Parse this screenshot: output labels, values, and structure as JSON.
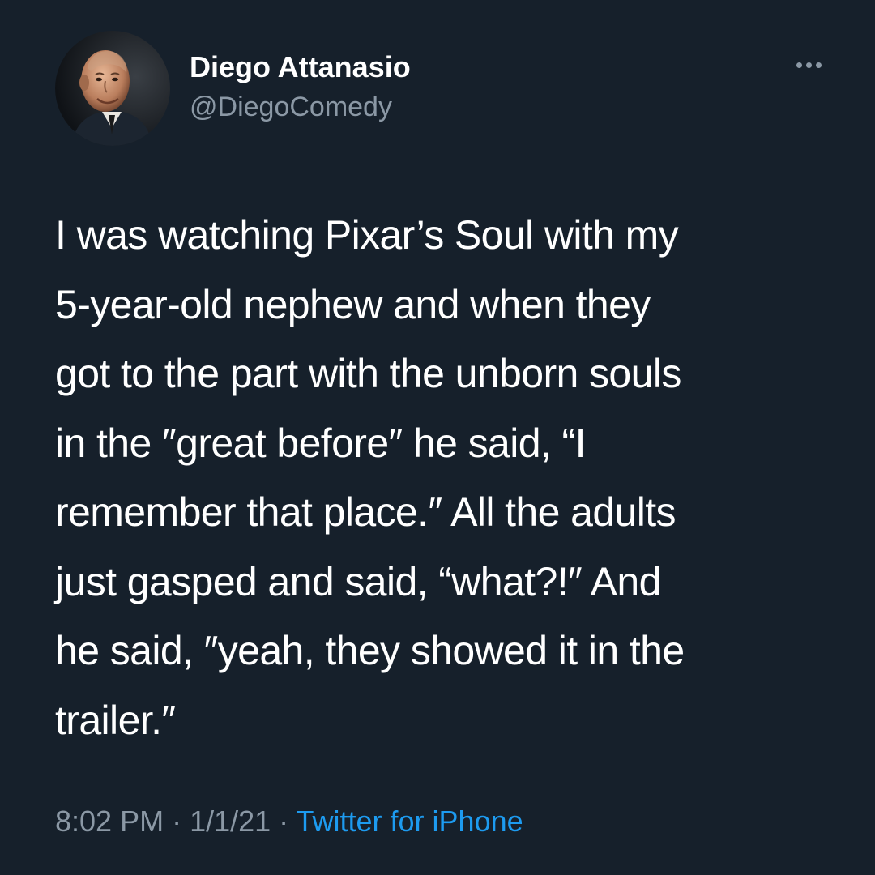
{
  "author": {
    "display_name": "Diego Attanasio",
    "handle": "@DiegoComedy",
    "avatar_icon": "profile-photo"
  },
  "menu": {
    "icon": "more-options-icon"
  },
  "tweet": {
    "text": "I was watching Pixar’s Soul with my\n5-year-old nephew and when they\ngot to the part with the unborn souls\nin the ″great before″ he said, “I\nremember that place.″ All the adults\njust gasped and said, “what?!″ And\nhe said, ″yeah, they showed it in the\ntrailer.″"
  },
  "meta": {
    "time": "8:02 PM",
    "separator": " · ",
    "date": "1/1/21",
    "source": "Twitter for iPhone"
  },
  "colors": {
    "background": "#16202b",
    "text_primary": "#ffffff",
    "text_secondary": "#8b98a5",
    "link": "#1d9bf0"
  }
}
